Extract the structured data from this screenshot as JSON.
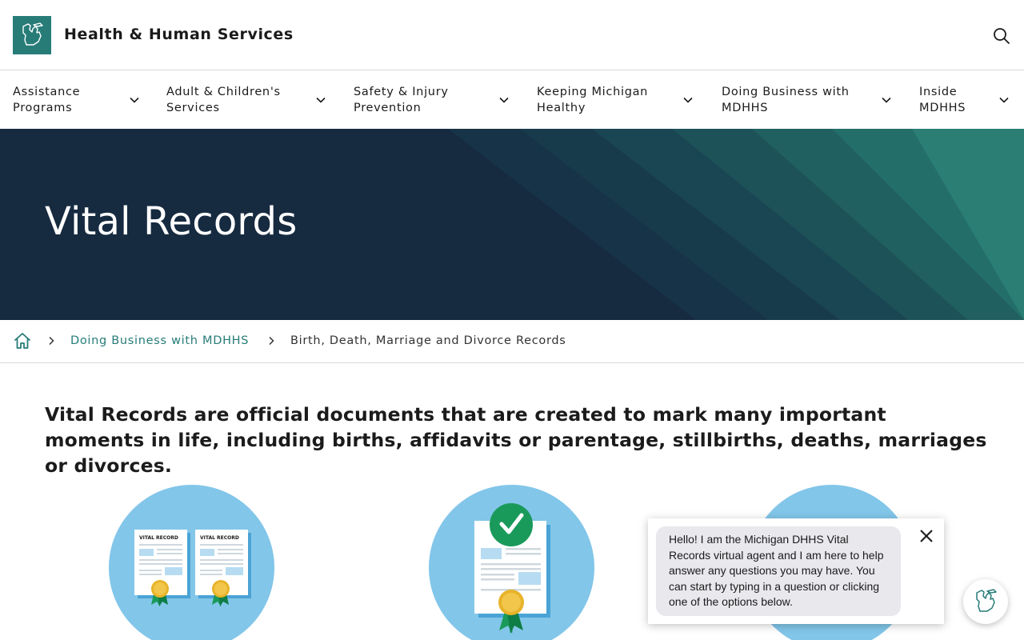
{
  "header": {
    "site_title": "Health & Human Services",
    "logo_icon": "michigan-state-outline-icon",
    "search_icon": "search-icon"
  },
  "nav": {
    "items": [
      {
        "line1": "Assistance",
        "line2": "Programs"
      },
      {
        "line1": "Adult & Children's",
        "line2": "Services"
      },
      {
        "line1": "Safety & Injury",
        "line2": "Prevention"
      },
      {
        "line1": "Keeping Michigan",
        "line2": "Healthy"
      },
      {
        "line1": "Doing Business with",
        "line2": "MDHHS"
      },
      {
        "line1": "Inside",
        "line2": "MDHHS"
      }
    ]
  },
  "hero": {
    "title": "Vital Records"
  },
  "breadcrumb": {
    "link": "Doing Business with MDHHS",
    "current": "Birth, Death, Marriage and Divorce Records"
  },
  "intro": {
    "text": "Vital Records are official documents that are created to mark many important moments in life, including births, affidavits or parentage, stillbirths, deaths, marriages or divorces."
  },
  "cards": {
    "card1_label_a": "VITAL RECORD",
    "card1_label_b": "VITAL RECORD"
  },
  "chat": {
    "message": "Hello! I am the Michigan DHHS Vital Records virtual agent and I am here to help answer any questions you may have. You can start by typing in a question or clicking one of the options below."
  },
  "colors": {
    "brand_teal": "#277c78",
    "hero_navy": "#162a40",
    "circle_blue": "#82c6e9"
  }
}
